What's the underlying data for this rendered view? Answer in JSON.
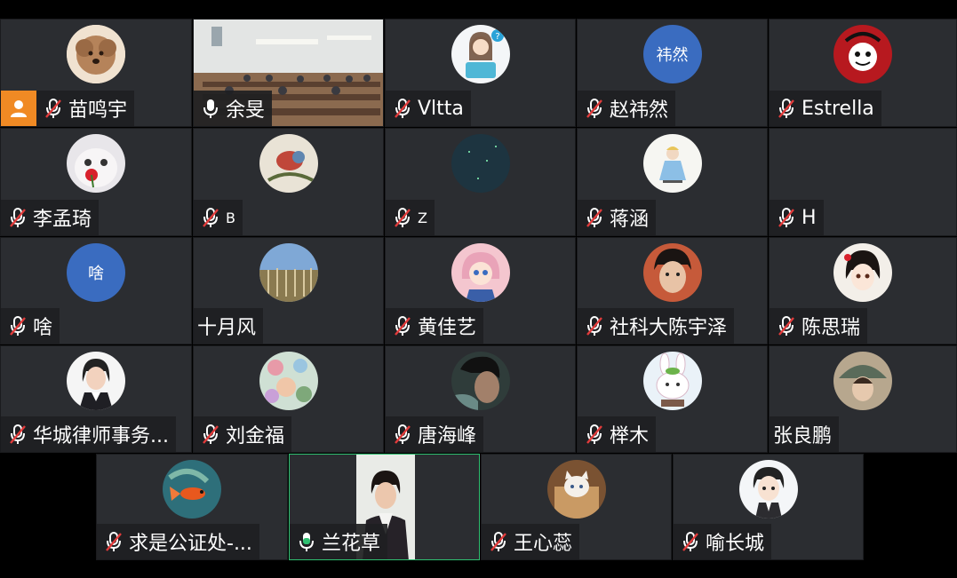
{
  "meeting": {
    "participants": [
      {
        "name": "苗鸣宇",
        "mic": "muted",
        "avatar": "dog-photo",
        "host_icon": "person-icon",
        "accent": "#f08a24"
      },
      {
        "name": "余旻",
        "mic": "on",
        "video": "classroom-camera"
      },
      {
        "name": "Vltta",
        "mic": "muted",
        "avatar": "cartoon-girl-laptop"
      },
      {
        "name": "赵祎然",
        "mic": "muted",
        "avatar_initials": "祎然",
        "avatar_color": "#3a6cc0"
      },
      {
        "name": "Estrella",
        "mic": "muted",
        "avatar": "red-cartoon"
      },
      {
        "name": "李孟琦",
        "mic": "muted",
        "avatar": "cat-rose-photo"
      },
      {
        "name": "B",
        "mic": "muted",
        "avatar": "bird-painting"
      },
      {
        "name": "Z",
        "mic": "muted",
        "avatar": "dark-sky"
      },
      {
        "name": "蒋涵",
        "mic": "muted",
        "avatar": "alice-illustration"
      },
      {
        "name": "H",
        "mic": "muted"
      },
      {
        "name": "啥",
        "mic": "muted",
        "avatar_initials": "啥",
        "avatar_color": "#3a6cc0"
      },
      {
        "name": "十月风",
        "mic": "none",
        "avatar": "forest-photo"
      },
      {
        "name": "黄佳艺",
        "mic": "muted",
        "avatar": "anime-pink-girl"
      },
      {
        "name": "社科大陈宇泽",
        "mic": "muted",
        "avatar": "young-man-photo"
      },
      {
        "name": "陈思瑞",
        "mic": "muted",
        "avatar": "anime-girl"
      },
      {
        "name": "华城律师事务...",
        "mic": "muted",
        "avatar": "woman-portrait"
      },
      {
        "name": "刘金福",
        "mic": "muted",
        "avatar": "floral-pattern"
      },
      {
        "name": "唐海峰",
        "mic": "muted",
        "avatar": "man-dark-photo"
      },
      {
        "name": "榉木",
        "mic": "muted",
        "avatar": "bunny-cartoon"
      },
      {
        "name": "张良鹏",
        "mic": "none",
        "avatar": "girl-umbrella"
      },
      {
        "name": "求是公证处-...",
        "mic": "muted",
        "avatar": "goldfish-painting"
      },
      {
        "name": "兰花草",
        "mic": "speaking",
        "video": "woman-camera",
        "active_color": "#2fbf71"
      },
      {
        "name": "王心蕊",
        "mic": "muted",
        "avatar": "cat-box-photo"
      },
      {
        "name": "喻长城",
        "mic": "muted",
        "avatar": "cartoon-boy"
      }
    ]
  }
}
